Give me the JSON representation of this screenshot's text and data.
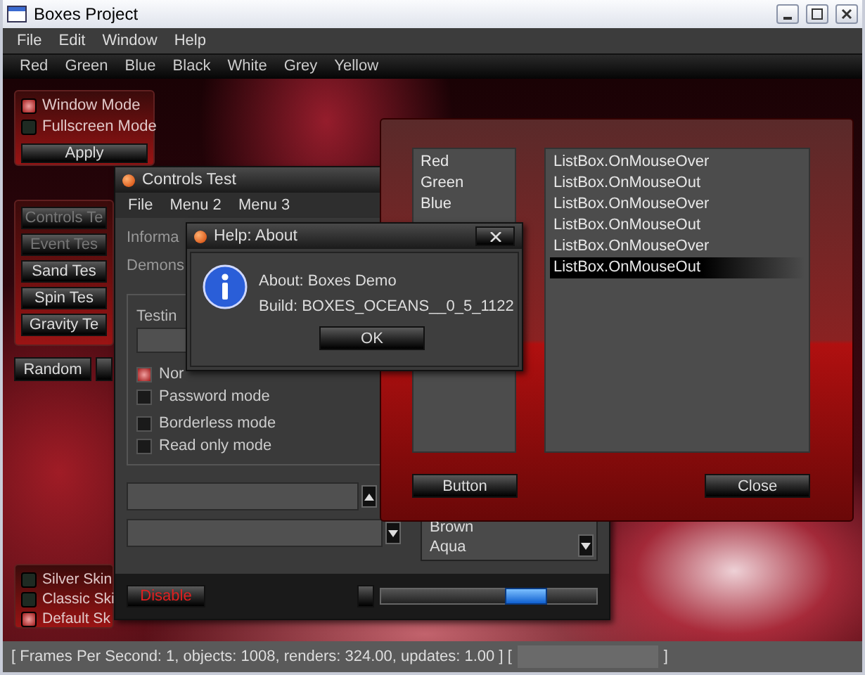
{
  "window": {
    "title": "Boxes Project"
  },
  "menu": [
    "File",
    "Edit",
    "Window",
    "Help"
  ],
  "color_bar": [
    "Red",
    "Green",
    "Blue",
    "Black",
    "White",
    "Grey",
    "Yellow"
  ],
  "mode_panel": {
    "options": [
      {
        "label": "Window Mode",
        "selected": true
      },
      {
        "label": "Fullscreen Mode",
        "selected": false
      }
    ],
    "button": "Apply"
  },
  "tests_panel": {
    "buttons": [
      {
        "label": "Controls Te",
        "disabled": true
      },
      {
        "label": "Event Tes",
        "disabled": true
      },
      {
        "label": "Sand Tes",
        "disabled": false
      },
      {
        "label": "Spin Tes",
        "disabled": false
      },
      {
        "label": "Gravity Te",
        "disabled": false
      }
    ]
  },
  "random_button": "Random",
  "skin_panel": {
    "options": [
      {
        "label": "Silver Skin",
        "selected": false
      },
      {
        "label": "Classic Ski",
        "selected": false
      },
      {
        "label": "Default Sk",
        "selected": true
      }
    ]
  },
  "controls_window": {
    "title": "Controls Test",
    "menu": [
      "File",
      "Menu 2",
      "Menu 3"
    ],
    "info_lines": [
      "Informa",
      "Demons"
    ],
    "group_label": "Testin",
    "checkboxes": [
      {
        "label": "Nor",
        "checked": true
      },
      {
        "label": "Password mode",
        "checked": false
      },
      {
        "label": "Borderless mode",
        "checked": false
      },
      {
        "label": "Read only mode",
        "checked": false
      }
    ],
    "list_items": [
      "Brown",
      "Aqua"
    ],
    "disable_button": "Disable",
    "slider": {
      "level": 0.67
    }
  },
  "list_window": {
    "left_list": [
      "Red",
      "Green",
      "Blue"
    ],
    "right_list": [
      {
        "text": "ListBox.OnMouseOver",
        "selected": false
      },
      {
        "text": "ListBox.OnMouseOut",
        "selected": false
      },
      {
        "text": "ListBox.OnMouseOver",
        "selected": false
      },
      {
        "text": "ListBox.OnMouseOut",
        "selected": false
      },
      {
        "text": "ListBox.OnMouseOver",
        "selected": false
      },
      {
        "text": "ListBox.OnMouseOut",
        "selected": true
      }
    ],
    "buttons": [
      "Button",
      "Close"
    ]
  },
  "about_dialog": {
    "title": "Help: About",
    "lines": [
      "About: Boxes Demo",
      "Build: BOXES_OCEANS__0_5_1122"
    ],
    "button": "OK"
  },
  "status_bar": {
    "text": "[ Frames Per Second: 1, objects: 1008, renders: 324.00, updates: 1.00 ] [",
    "end": "]"
  }
}
